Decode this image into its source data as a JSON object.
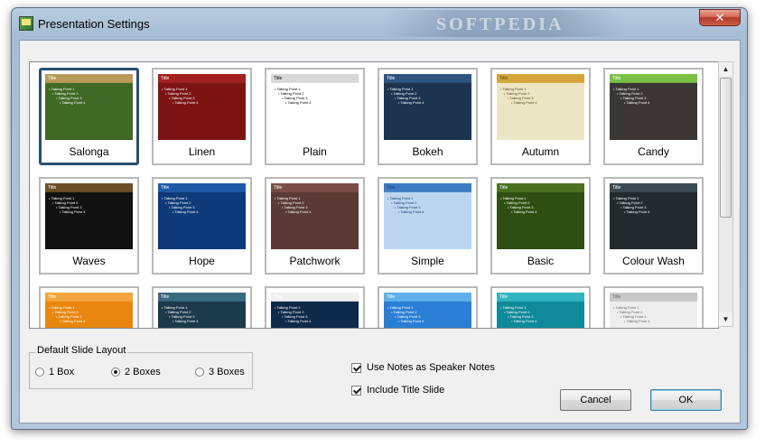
{
  "window": {
    "title": "Presentation Settings",
    "watermark": "SOFTPEDIA",
    "close_label": "✕"
  },
  "gallery": {
    "selected": "Salonga",
    "themes": [
      {
        "name": "Salonga",
        "bg": "#3f6a24",
        "accent": "#b79a5a",
        "text": "#ffffff"
      },
      {
        "name": "Linen",
        "bg": "#7c1313",
        "accent": "#a32020",
        "text": "#ffffff"
      },
      {
        "name": "Plain",
        "bg": "#ffffff",
        "accent": "#d8d8d8",
        "text": "#000000"
      },
      {
        "name": "Bokeh",
        "bg": "#1c3450",
        "accent": "#2f5580",
        "text": "#ffffff"
      },
      {
        "name": "Autumn",
        "bg": "#ece6c4",
        "accent": "#d6a53a",
        "text": "#5a4a20"
      },
      {
        "name": "Candy",
        "bg": "#3a3634",
        "accent": "#7ac143",
        "text": "#ffffff"
      },
      {
        "name": "Waves",
        "bg": "#111111",
        "accent": "#6b4f2a",
        "text": "#ffffff"
      },
      {
        "name": "Hope",
        "bg": "#0d3a78",
        "accent": "#1f5aa8",
        "text": "#ffffff"
      },
      {
        "name": "Patchwork",
        "bg": "#5b3a35",
        "accent": "#7a4e48",
        "text": "#ffffff"
      },
      {
        "name": "Simple",
        "bg": "#bcd6ef",
        "accent": "#3c7cc2",
        "text": "#1a3a6a"
      },
      {
        "name": "Basic",
        "bg": "#2f4f12",
        "accent": "#4a7020",
        "text": "#ffffff"
      },
      {
        "name": "Colour Wash",
        "bg": "#222a2e",
        "accent": "#3b4a52",
        "text": "#ffffff"
      },
      {
        "name": "",
        "bg": "#e8870f",
        "accent": "#f2a53a",
        "text": "#ffffff"
      },
      {
        "name": "",
        "bg": "#1b3a4c",
        "accent": "#3a6a80",
        "text": "#ffffff"
      },
      {
        "name": "",
        "bg": "#0e2a4a",
        "accent": "#f0f0f0",
        "text": "#ffffff"
      },
      {
        "name": "",
        "bg": "#2a7fd4",
        "accent": "#5fb0ec",
        "text": "#ffffff"
      },
      {
        "name": "",
        "bg": "#0f8a9a",
        "accent": "#34b4c0",
        "text": "#ffffff"
      },
      {
        "name": "",
        "bg": "#eeeeee",
        "accent": "#c8c8c8",
        "text": "#666666"
      }
    ],
    "thumb_text": {
      "title": "Title",
      "lines": [
        "Talking Point 1",
        "Talking Point 2",
        "Talking Point 3",
        "Talking Point 4"
      ]
    }
  },
  "layout_group": {
    "legend": "Default Slide Layout",
    "options": [
      {
        "label": "1 Box",
        "checked": false
      },
      {
        "label": "2 Boxes",
        "checked": true
      },
      {
        "label": "3 Boxes",
        "checked": false
      }
    ]
  },
  "checkboxes": [
    {
      "label": "Use Notes as Speaker Notes",
      "checked": true
    },
    {
      "label": "Include Title Slide",
      "checked": true
    }
  ],
  "buttons": {
    "cancel": "Cancel",
    "ok": "OK"
  },
  "scrollbar": {
    "up_arrow": "▲",
    "down_arrow": "▼"
  }
}
